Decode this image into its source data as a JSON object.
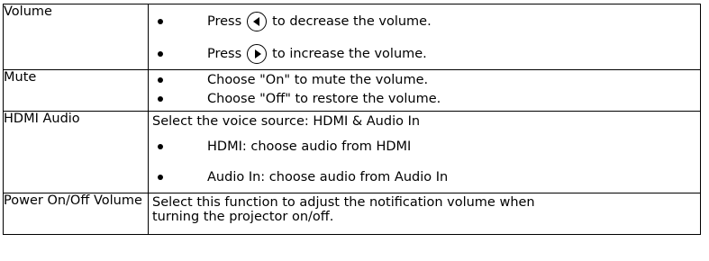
{
  "rows": [
    {
      "name": "Volume",
      "items": [
        {
          "pre": "Press",
          "icon": "left-arrow-icon",
          "post": "to decrease the volume."
        },
        {
          "pre": "Press",
          "icon": "right-arrow-icon",
          "post": "to increase the volume."
        }
      ]
    },
    {
      "name": "Mute",
      "items": [
        "Choose \"On\" to mute the volume.",
        "Choose \"Off\" to restore the volume."
      ]
    },
    {
      "name": "HDMI Audio",
      "intro": "Select the voice source: HDMI & Audio In",
      "items": [
        "HDMI: choose audio from HDMI",
        "Audio In: choose audio from Audio In"
      ]
    },
    {
      "name": "Power On/Off Volume",
      "text_line1": "Select this function to adjust the notification volume when",
      "text_line2": "turning the projector on/off."
    }
  ]
}
